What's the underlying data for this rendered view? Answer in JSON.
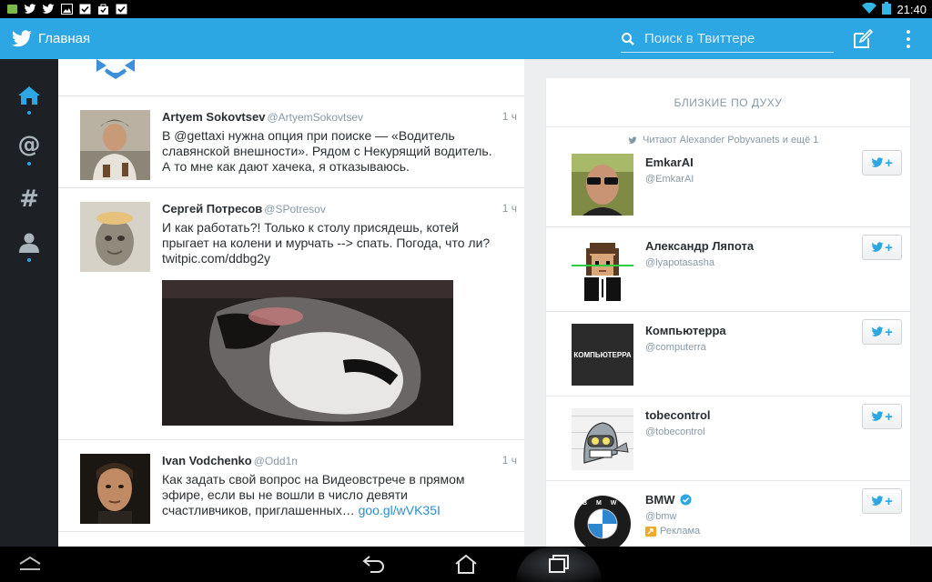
{
  "status_bar": {
    "left_icons": [
      "sim-icon",
      "twitter-notification-icon",
      "twitter-notification-icon",
      "image-icon",
      "check-icon",
      "bag-icon",
      "check-icon"
    ],
    "time": "21:40"
  },
  "action_bar": {
    "title": "Главная",
    "search_placeholder": "Поиск в Твиттере",
    "accent": "#2da6e4"
  },
  "sidebar": {
    "items": [
      {
        "name": "home",
        "icon": "home-icon",
        "active": true
      },
      {
        "name": "connect",
        "icon": "at-icon",
        "active": false
      },
      {
        "name": "discover",
        "icon": "hashtag-icon",
        "active": false
      },
      {
        "name": "me",
        "icon": "person-icon",
        "active": false
      }
    ]
  },
  "timeline": {
    "tweets": [
      {
        "name": "Artyem Sokovtsev",
        "handle": "@ArtyemSokovtsev",
        "time": "1 ч",
        "text": "В @gettaxi нужна опция при поиске — «Водитель славянской внешности». Рядом с Некурящий водитель. А то мне как дают хачека, я отказываюсь."
      },
      {
        "name": "Сергей Потресов",
        "handle": "@SPotresov",
        "time": "1 ч",
        "text": "И как работать?! Только к столу присядешь, котей прыгает на колени и мурчать --> спать. Погода, что ли? twitpic.com/ddbg2y"
      },
      {
        "name": "Ivan Vodchenko",
        "handle": "@Odd1n",
        "time": "1 ч",
        "text": "Как задать свой вопрос на Видеовстрече в прямом эфире, если вы не вошли в число девяти счастливчиков, приглашенных…",
        "link": "goo.gl/wVK35I"
      }
    ]
  },
  "who_to_follow": {
    "title": "БЛИЗКИЕ ПО ДУХУ",
    "context": "Читают Alexander Pobyvanets и ещё 1",
    "users": [
      {
        "name": "EmkarAI",
        "handle": "@EmkarAI"
      },
      {
        "name": "Александр Ляпота",
        "handle": "@lyapotasasha"
      },
      {
        "name": "Компьютерра",
        "handle": "@computerra",
        "avatar_text": "КОМПЬЮТЕРРА"
      },
      {
        "name": "tobecontrol",
        "handle": "@tobecontrol"
      },
      {
        "name": "BMW",
        "handle": "@bmw",
        "verified": true,
        "promoted": "Реклама",
        "avatar_text": "B M W"
      }
    ],
    "follow_label": "+"
  }
}
